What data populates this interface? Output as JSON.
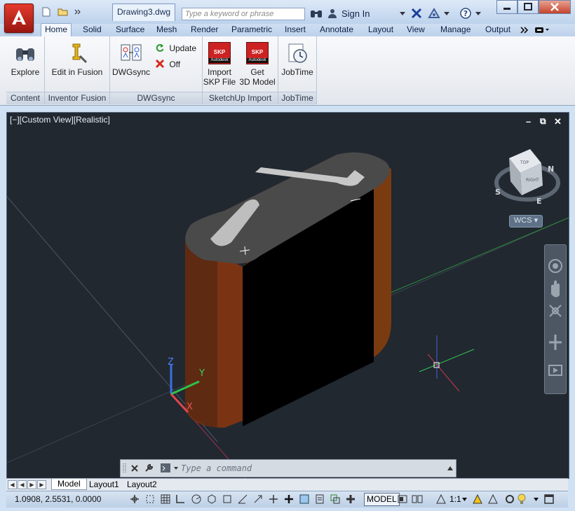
{
  "titlebar": {
    "doc_name": "Drawing3.dwg",
    "search_placeholder": "Type a keyword or phrase",
    "sign_in": "Sign In"
  },
  "ribbon_tabs": [
    "Home",
    "Solid",
    "Surface",
    "Mesh",
    "Render",
    "Parametric",
    "Insert",
    "Annotate",
    "Layout",
    "View",
    "Manage",
    "Output"
  ],
  "active_tab": "Home",
  "ribbon": {
    "content": {
      "title": "Content",
      "explore": "Explore"
    },
    "inventor": {
      "title": "Inventor Fusion",
      "edit": "Edit in Fusion"
    },
    "dwgsync": {
      "title": "DWGsync",
      "main": "DWGsync",
      "update": "Update",
      "off": "Off"
    },
    "sketchup": {
      "title": "SketchUp Import",
      "import_1": "Import",
      "import_2": "SKP File",
      "get_1": "Get",
      "get_2": "3D Model",
      "badge_skp": "SKP",
      "badge_autodesk": "Autodesk"
    },
    "jobtime": {
      "title": "JobTime",
      "main": "JobTime"
    }
  },
  "viewport": {
    "label": "[−][Custom View][Realistic]",
    "wcs": "WCS",
    "viewcube": {
      "top": "TOP",
      "right": "RIGHT",
      "n": "N",
      "e": "E",
      "s": "S"
    },
    "ucs": {
      "x": "X",
      "y": "Y",
      "z": "Z"
    }
  },
  "command": {
    "placeholder": "Type a command"
  },
  "layout_tabs": [
    "Model",
    "Layout1",
    "Layout2"
  ],
  "status": {
    "coords": "1.0908, 2.5531, 0.0000",
    "model": "MODEL",
    "scale": "1:1"
  }
}
